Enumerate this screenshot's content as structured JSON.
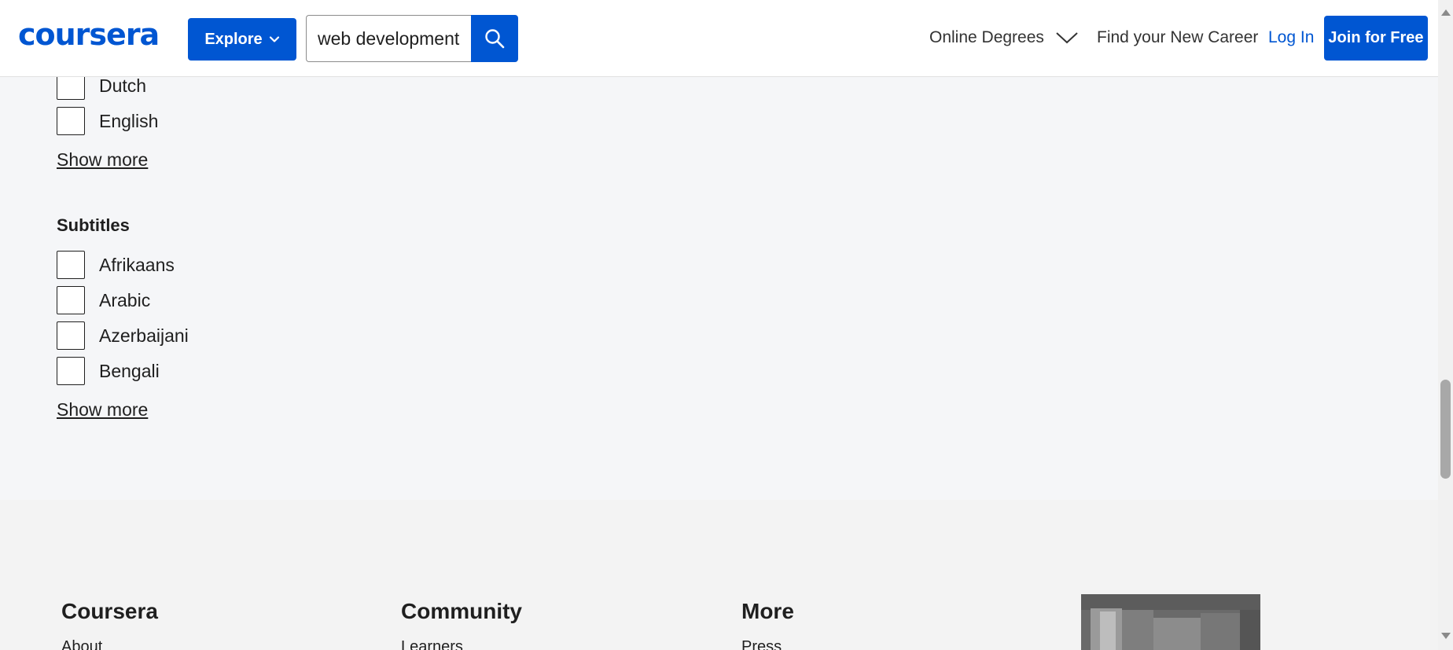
{
  "header": {
    "logo": "coursera",
    "explore_label": "Explore",
    "search_value": "web development",
    "nav": {
      "online_degrees": "Online Degrees",
      "find_career": "Find your New Career",
      "login": "Log In",
      "join": "Join for Free"
    }
  },
  "language_filter": {
    "items": [
      {
        "label": "Dutch",
        "checked": false
      },
      {
        "label": "English",
        "checked": false
      }
    ],
    "show_more": "Show more"
  },
  "subtitles_filter": {
    "title": "Subtitles",
    "items": [
      {
        "label": "Afrikaans",
        "checked": false
      },
      {
        "label": "Arabic",
        "checked": false
      },
      {
        "label": "Azerbaijani",
        "checked": false
      },
      {
        "label": "Bengali",
        "checked": false
      }
    ],
    "show_more": "Show more"
  },
  "footer": {
    "columns": [
      {
        "heading": "Coursera",
        "first_link": "About"
      },
      {
        "heading": "Community",
        "first_link": "Learners"
      },
      {
        "heading": "More",
        "first_link": "Press"
      }
    ]
  },
  "colors": {
    "brand": "#0056d2",
    "page_bg": "#f5f6f8",
    "footer_bg": "#f3f3f3"
  },
  "icons": [
    "chevron-down-icon",
    "search-icon",
    "chevron-down-icon"
  ]
}
